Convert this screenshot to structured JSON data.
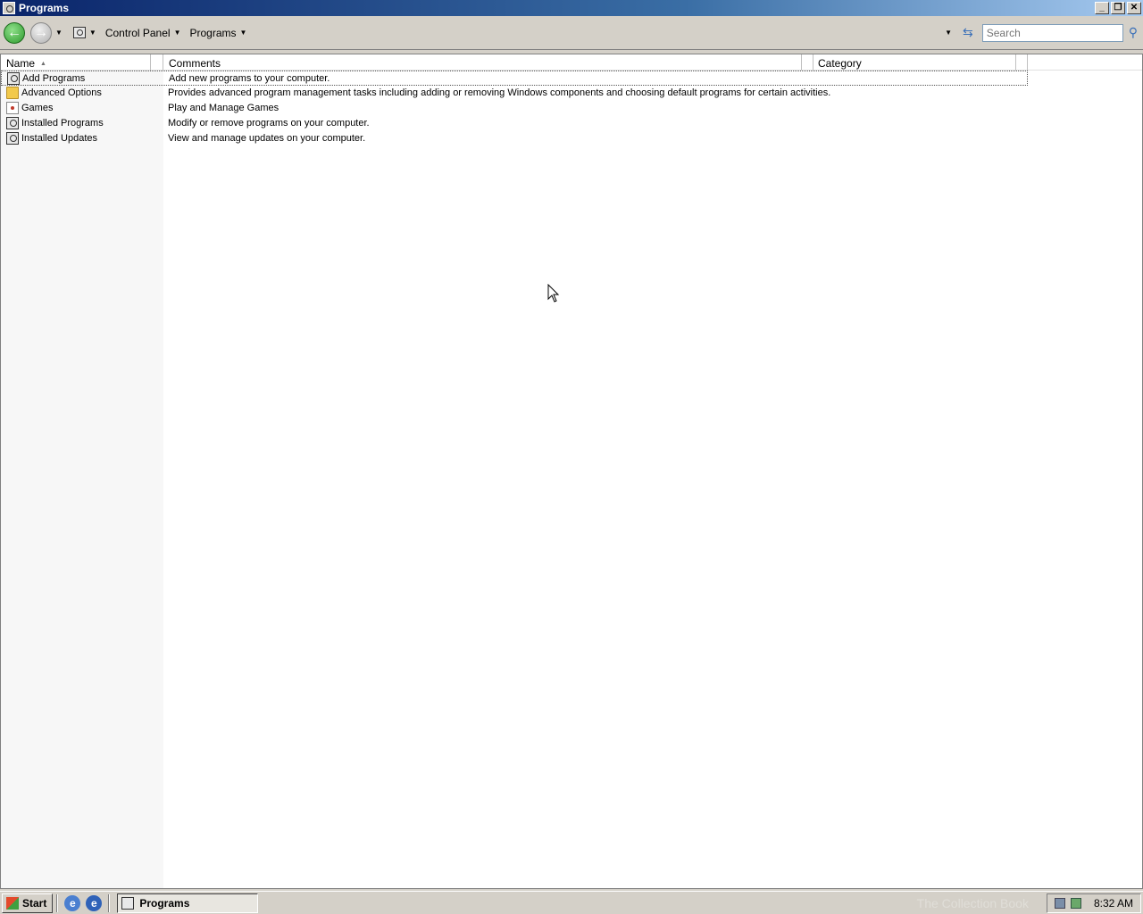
{
  "window": {
    "title": "Programs",
    "controls": {
      "minimize": "_",
      "restore": "❐",
      "close": "✕"
    }
  },
  "nav": {
    "back_icon": "back-arrow-icon",
    "forward_icon": "forward-arrow-icon",
    "breadcrumb": [
      "Control Panel",
      "Programs"
    ],
    "search_placeholder": "Search"
  },
  "columns": [
    "Name",
    "Comments",
    "Category"
  ],
  "items": [
    {
      "name": "Add Programs",
      "comment": "Add new programs to your computer.",
      "category": "",
      "icon": "control-panel-icon"
    },
    {
      "name": "Advanced Options",
      "comment": "Provides advanced program management tasks including adding or removing Windows components and choosing default programs for certain activities.",
      "category": "",
      "icon": "folder-icon"
    },
    {
      "name": "Games",
      "comment": "Play and Manage Games",
      "category": "",
      "icon": "games-icon"
    },
    {
      "name": "Installed Programs",
      "comment": "Modify or remove programs on your computer.",
      "category": "",
      "icon": "control-panel-icon"
    },
    {
      "name": "Installed Updates",
      "comment": "View and manage updates on your computer.",
      "category": "",
      "icon": "control-panel-icon"
    }
  ],
  "taskbar": {
    "start_label": "Start",
    "task_label": "Programs",
    "clock": "8:32 AM",
    "watermark": "The Collection Book"
  }
}
